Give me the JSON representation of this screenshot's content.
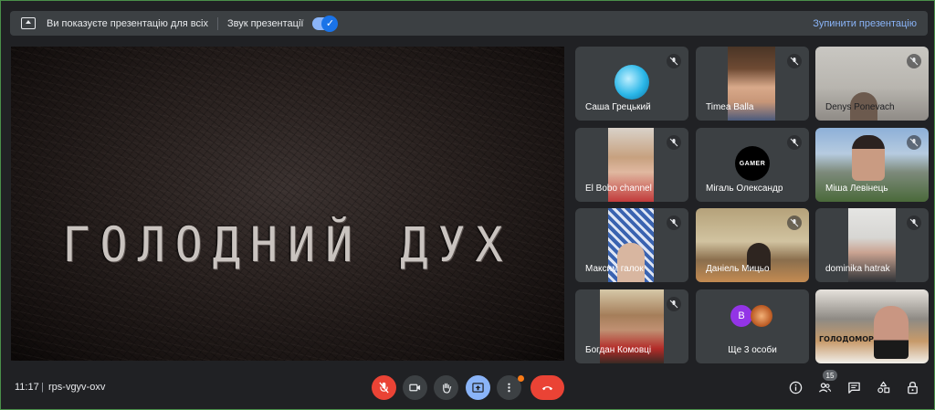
{
  "banner": {
    "message": "Ви показуєте презентацію для всіх",
    "audio_label": "Звук презентації",
    "audio_enabled": true,
    "stop_label": "Зупинити презентацію"
  },
  "presentation": {
    "title_text": "ГОЛОДНИЙ ДУХ"
  },
  "participants": [
    {
      "name": "Саша Грецький",
      "muted": true
    },
    {
      "name": "Timea Balla",
      "muted": true
    },
    {
      "name": "Denys Ponevach",
      "muted": true
    },
    {
      "name": "El Bobo channel",
      "muted": true
    },
    {
      "name": "Мігаль Олександр",
      "muted": true
    },
    {
      "name": "Міша Левінець",
      "muted": true
    },
    {
      "name": "Максим галок",
      "muted": true
    },
    {
      "name": "Даніель Мицьо",
      "muted": true
    },
    {
      "name": "dominika hatrak",
      "muted": true
    },
    {
      "name": "Богдан Комовці",
      "muted": true
    },
    {
      "name": "Ще 3 особи",
      "muted": false,
      "avatar_letter": "В"
    },
    {
      "name": "",
      "muted": false,
      "slide_text": "ГОЛОДОМОР"
    }
  ],
  "bottom_bar": {
    "time": "11:17",
    "separator": "|",
    "meeting_code": "rps-vgyv-oxv",
    "participant_count": "15"
  },
  "colors": {
    "background": "#202124",
    "tile": "#3c4043",
    "accent_blue": "#8ab4f8",
    "danger_red": "#ea4335",
    "notify_orange": "#fa7b17"
  },
  "icons": {
    "mic_off": "mic-off-icon",
    "camera": "camera-icon",
    "hand": "raise-hand-icon",
    "present": "present-screen-icon",
    "more": "more-vert-icon",
    "end_call": "end-call-icon",
    "info": "info-icon",
    "people": "people-icon",
    "chat": "chat-icon",
    "activities": "activities-icon",
    "lock": "host-controls-icon"
  }
}
